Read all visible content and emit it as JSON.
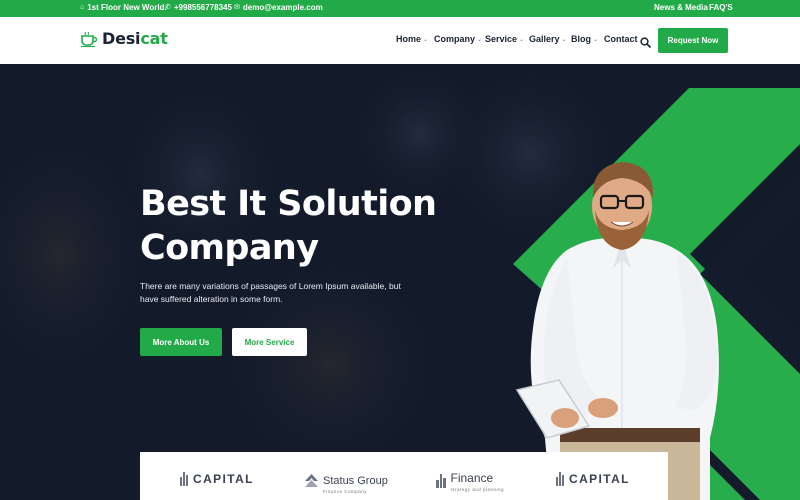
{
  "topbar": {
    "address": "1st Floor New World.",
    "phone": "+9985567783 45",
    "email": "demo@example.com",
    "links": [
      "News & Media",
      "FAQ'S"
    ]
  },
  "header": {
    "logo_main": "Desi",
    "logo_accent": "cat",
    "nav": [
      "Home",
      "Company",
      "Service",
      "Gallery",
      "Blog",
      "Contact"
    ],
    "request_label": "Request Now"
  },
  "hero": {
    "title_line1": "Best It Solution",
    "title_line2": "Company",
    "description": "There are many variations of passages of Lorem Ipsum available, but have suffered alteration in some form.",
    "btn_primary": "More About Us",
    "btn_secondary": "More Service"
  },
  "brands": [
    {
      "name": "CAPITAL",
      "sub": ""
    },
    {
      "name": "Status Group",
      "sub": "Finance Company"
    },
    {
      "name": "Finance",
      "sub": "strategy and planning"
    },
    {
      "name": "CAPITAL",
      "sub": ""
    }
  ],
  "colors": {
    "accent": "#22a948",
    "dark": "#141c2c",
    "text": "#1a2333"
  },
  "icons": [
    "home-icon",
    "phone-icon",
    "mail-icon",
    "coffee-cup-icon",
    "search-icon",
    "chevron-down-icon"
  ]
}
